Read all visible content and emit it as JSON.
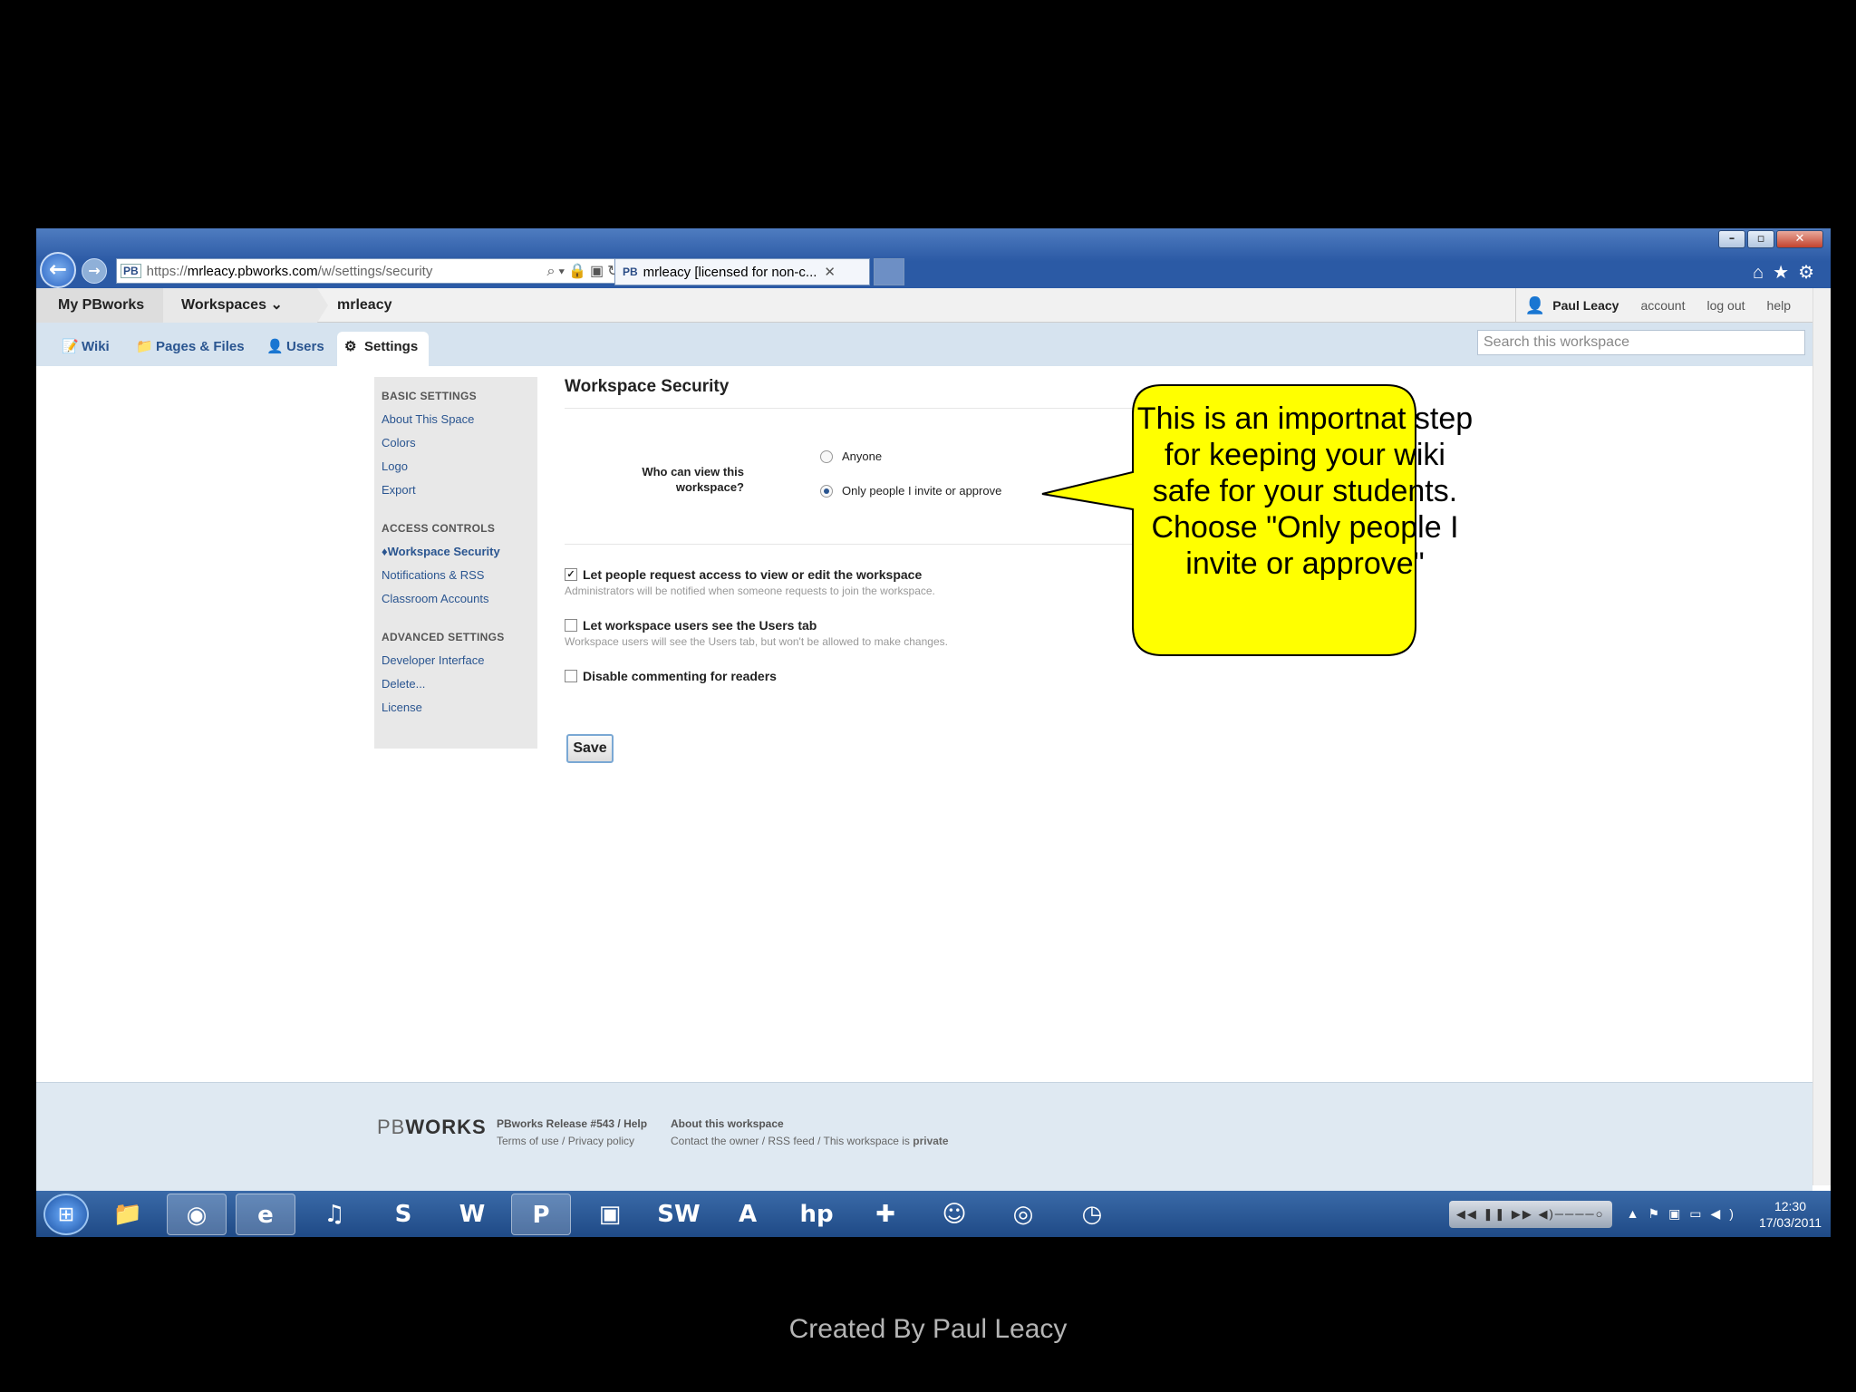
{
  "browser": {
    "url_prefix": "https://",
    "url_host": "mrleacy.pbworks.com",
    "url_path": "/w/settings/security",
    "favicon": "PB",
    "tab_title": "mrleacy [licensed for non-c...",
    "window_buttons": [
      "–",
      "▫",
      "✕"
    ]
  },
  "topbar": {
    "crumbs": [
      "My PBworks",
      "Workspaces",
      "mrleacy"
    ],
    "user_name": "Paul Leacy",
    "links": [
      "account",
      "log out",
      "help"
    ]
  },
  "tabs": [
    {
      "label": "Wiki",
      "icon": "wiki-icon"
    },
    {
      "label": "Pages & Files",
      "icon": "folder-icon"
    },
    {
      "label": "Users",
      "icon": "users-icon"
    },
    {
      "label": "Settings",
      "icon": "gear-icon"
    }
  ],
  "search": {
    "placeholder": "Search this workspace"
  },
  "sidebar": {
    "basic_header": "BASIC SETTINGS",
    "basic_items": [
      "About This Space",
      "Colors",
      "Logo",
      "Export"
    ],
    "access_header": "ACCESS CONTROLS",
    "access_items": [
      "Workspace Security",
      "Notifications & RSS",
      "Classroom Accounts"
    ],
    "advanced_header": "ADVANCED SETTINGS",
    "advanced_items": [
      "Developer Interface",
      "Delete...",
      "License"
    ]
  },
  "main": {
    "title": "Workspace Security",
    "question": "Who can view this workspace?",
    "options": [
      "Anyone",
      "Only people I invite or approve"
    ],
    "selected_option": "Only people I invite or approve",
    "checks": [
      {
        "label": "Let people request access to view or edit the workspace",
        "hint": "Administrators will be notified when someone requests to join the workspace.",
        "checked": true
      },
      {
        "label": "Let workspace users see the Users tab",
        "hint": "Workspace users will see the Users tab, but won't be allowed to make changes.",
        "checked": false
      },
      {
        "label": "Disable commenting for readers",
        "hint": "",
        "checked": false
      }
    ],
    "save_label": "Save"
  },
  "callout": {
    "text": "This is an importnat step for keeping your wiki safe for your students. Choose \"Only people I invite or approve\"",
    "fill": "#ffff00"
  },
  "footer": {
    "logo_pb": "PB",
    "logo_works": "WORKS",
    "col1_line1": "PBworks Release #543 / Help",
    "col1_line2": "Terms of use / Privacy policy",
    "col2_line1": "About this workspace",
    "col2_line2_prefix": "Contact the owner / RSS feed / This workspace is ",
    "col2_line2_bold": "private"
  },
  "taskbar": {
    "time": "12:30",
    "date": "17/03/2011"
  },
  "credit": "Created By Paul Leacy"
}
